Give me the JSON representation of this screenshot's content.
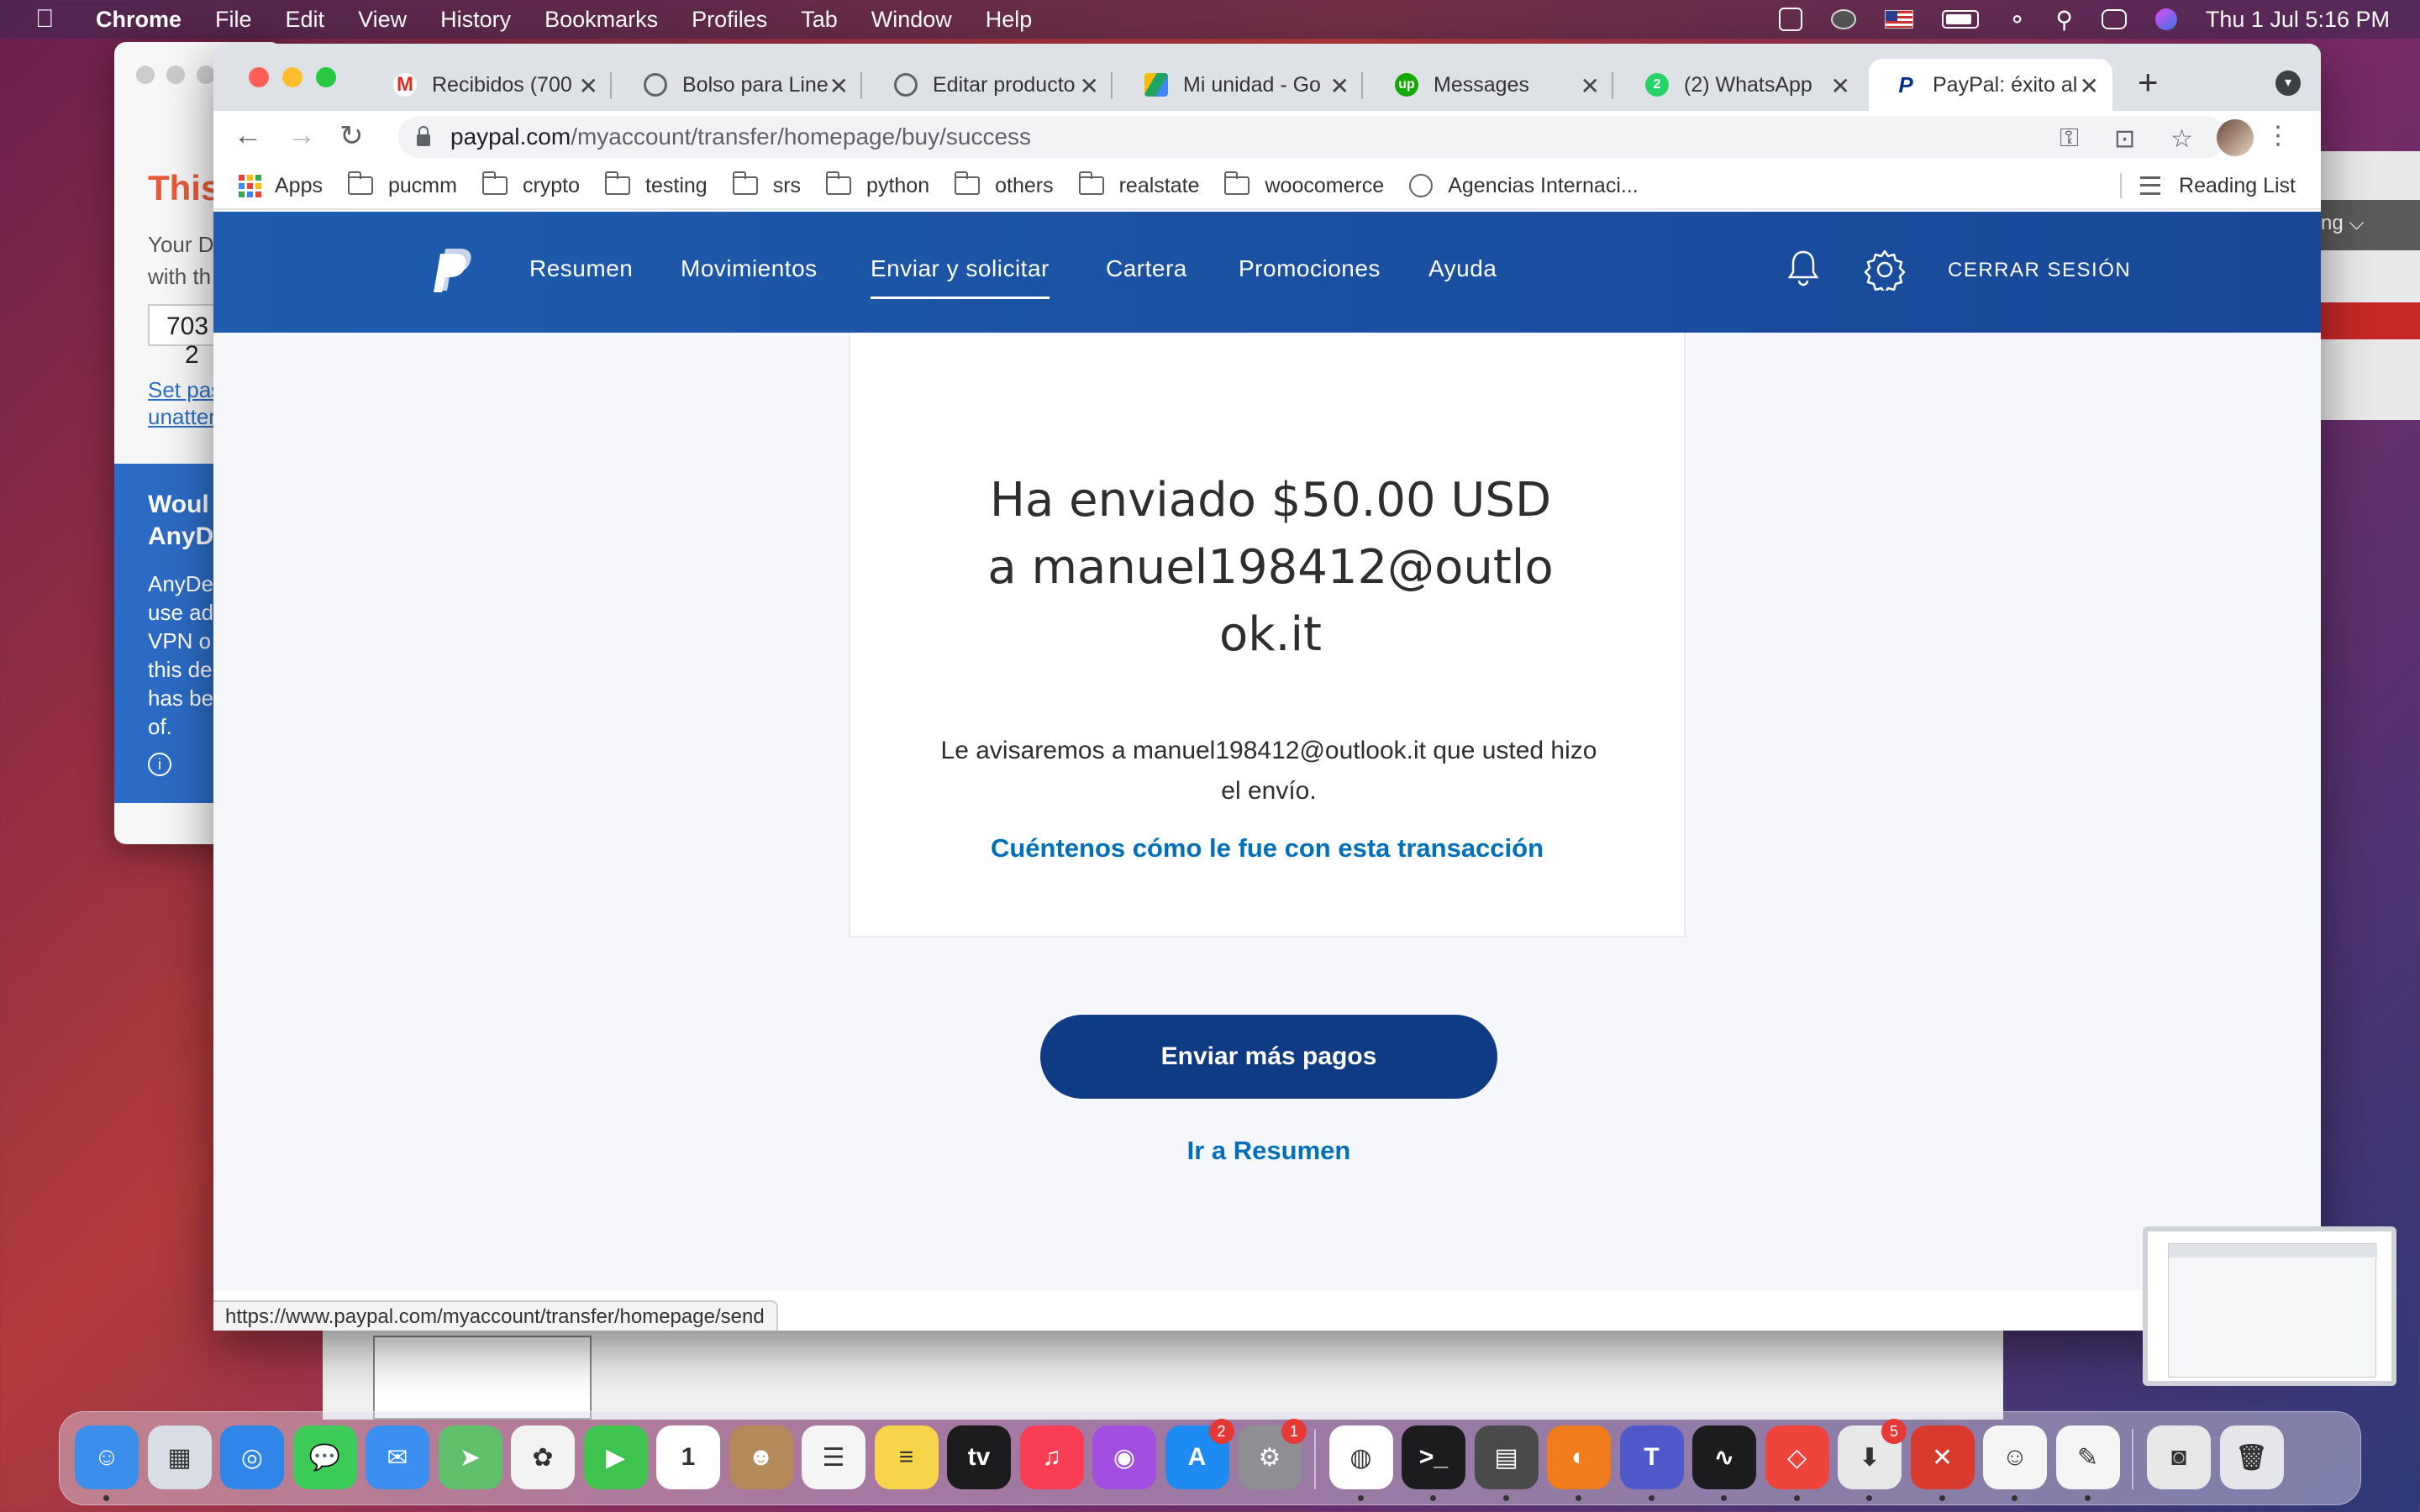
{
  "menubar": {
    "app": "Chrome",
    "items": [
      "File",
      "Edit",
      "View",
      "History",
      "Bookmarks",
      "Profiles",
      "Tab",
      "Window",
      "Help"
    ],
    "clock": "Thu 1 Jul  5:16 PM"
  },
  "anydesk": {
    "title": "This",
    "subtitle_line1": "Your D",
    "subtitle_line2": "with th",
    "address_value": "703 2",
    "link_line1": "Set pas",
    "link_line2": "unatten",
    "promo_heading_line1": "Woul",
    "promo_heading_line2": "AnyD",
    "promo_body": [
      "AnyDe",
      "use ad",
      "VPN o",
      "this de",
      "has be",
      "of."
    ]
  },
  "side_window": {
    "label": "ng ⌵"
  },
  "tabs": [
    {
      "label": "Recibidos (700",
      "icon": "gmail-icon",
      "color": "#d93025"
    },
    {
      "label": "Bolso para Line",
      "icon": "globe-icon",
      "color": "#5f6368"
    },
    {
      "label": "Editar producto",
      "icon": "globe-icon",
      "color": "#5f6368"
    },
    {
      "label": "Mi unidad - Go",
      "icon": "drive-icon",
      "color": "#1fa463"
    },
    {
      "label": "Messages",
      "icon": "upwork-icon",
      "color": "#14a800"
    },
    {
      "label": "(2) WhatsApp",
      "icon": "whatsapp-icon",
      "color": "#25d366"
    },
    {
      "label": "PayPal: éxito al",
      "icon": "paypal-icon",
      "color": "#003087"
    }
  ],
  "address_bar": {
    "host": "paypal.com",
    "path": "/myaccount/transfer/homepage/buy/success"
  },
  "bookmarks": {
    "apps_label": "Apps",
    "folders": [
      "pucmm",
      "crypto",
      "testing",
      "srs",
      "python",
      "others",
      "realstate",
      "woocomerce"
    ],
    "site": "Agencias Internaci...",
    "reading_list": "Reading List"
  },
  "paypal": {
    "nav": [
      "Resumen",
      "Movimientos",
      "Enviar y solicitar",
      "Cartera",
      "Promociones",
      "Ayuda"
    ],
    "active_nav": "Enviar y solicitar",
    "logout": "CERRAR SESIÓN",
    "headline": "Ha enviado $50.00 USD a manuel198412@outlook.it",
    "notice": "Le avisaremos a manuel198412@outlook.it que usted hizo el envío.",
    "feedback_link": "Cuéntenos cómo le fue con esta transacción",
    "primary_button": "Enviar más pagos",
    "secondary_link": "Ir a Resumen",
    "brand_color": "#0070ba",
    "button_color": "#0e3b84"
  },
  "status_bar": {
    "url": "https://www.paypal.com/myaccount/transfer/homepage/send"
  },
  "dock": [
    {
      "name": "finder-icon",
      "color": "#3b8eea",
      "glyph": "☺",
      "running": true
    },
    {
      "name": "launchpad-icon",
      "color": "#d8dde6",
      "glyph": "▦"
    },
    {
      "name": "safari-icon",
      "color": "#2f86e8",
      "glyph": "◎"
    },
    {
      "name": "messages-icon",
      "color": "#3ccb58",
      "glyph": "💬"
    },
    {
      "name": "mail-icon",
      "color": "#3a8ff0",
      "glyph": "✉"
    },
    {
      "name": "maps-icon",
      "color": "#5fbf6a",
      "glyph": "➤"
    },
    {
      "name": "photos-icon",
      "color": "#f2f2f2",
      "glyph": "✿"
    },
    {
      "name": "facetime-icon",
      "color": "#3fc34f",
      "glyph": "▶"
    },
    {
      "name": "calendar-icon",
      "color": "#ffffff",
      "glyph": "1"
    },
    {
      "name": "contacts-icon",
      "color": "#b58a5a",
      "glyph": "☻"
    },
    {
      "name": "reminders-icon",
      "color": "#f5f5f5",
      "glyph": "☰"
    },
    {
      "name": "notes-icon",
      "color": "#f7d54a",
      "glyph": "≡"
    },
    {
      "name": "apple-tv-icon",
      "color": "#1c1c1e",
      "glyph": "tv"
    },
    {
      "name": "music-icon",
      "color": "#fa3d53",
      "glyph": "♫"
    },
    {
      "name": "podcasts-icon",
      "color": "#a24ee0",
      "glyph": "◉"
    },
    {
      "name": "app-store-icon",
      "color": "#1d8bf2",
      "glyph": "A",
      "badge": "2"
    },
    {
      "name": "system-preferences-icon",
      "color": "#8e8e93",
      "glyph": "⚙",
      "badge": "1"
    },
    {
      "name": "chrome-icon",
      "color": "#ffffff",
      "glyph": "◍",
      "running": true
    },
    {
      "name": "terminal-icon",
      "color": "#1c1c1e",
      "glyph": ">_",
      "running": true
    },
    {
      "name": "calculator-icon",
      "color": "#4a4a4a",
      "glyph": "▤",
      "running": true
    },
    {
      "name": "vpn-icon",
      "color": "#f07c1b",
      "glyph": "◐",
      "running": true
    },
    {
      "name": "teams-icon",
      "color": "#5059c9",
      "glyph": "T",
      "running": true
    },
    {
      "name": "activity-monitor-icon",
      "color": "#1c1c1e",
      "glyph": "∿",
      "running": true
    },
    {
      "name": "anydesk-icon",
      "color": "#ef443b",
      "glyph": "◇",
      "running": true
    },
    {
      "name": "installer-icon",
      "color": "#e8e8e8",
      "glyph": "⬇",
      "badge": "5",
      "running": true
    },
    {
      "name": "remote-desktop-icon",
      "color": "#d83b2e",
      "glyph": "✕",
      "running": true
    },
    {
      "name": "smiley-app-icon",
      "color": "#f5f5f5",
      "glyph": "☺",
      "running": true
    },
    {
      "name": "textedit-icon",
      "color": "#f5f5f5",
      "glyph": "✎",
      "running": true
    },
    {
      "name": "screenshot-icon",
      "color": "#e8e8e8",
      "glyph": "◙"
    },
    {
      "name": "trash-icon",
      "color": "#e4e6ea",
      "glyph": "🗑"
    }
  ]
}
